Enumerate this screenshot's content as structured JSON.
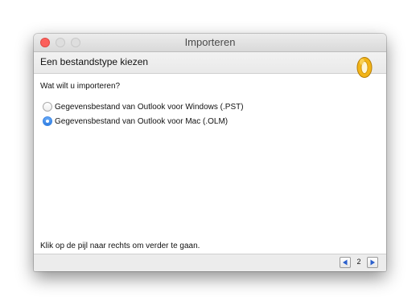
{
  "window": {
    "title": "Importeren"
  },
  "header": {
    "title": "Een bestandstype kiezen",
    "logo_icon": "outlook-logo-icon"
  },
  "content": {
    "question": "Wat wilt u importeren?",
    "options": [
      {
        "label": "Gegevensbestand van Outlook voor Windows (.PST)",
        "selected": false
      },
      {
        "label": "Gegevensbestand van Outlook voor Mac (.OLM)",
        "selected": true
      }
    ],
    "instruction": "Klik op de pijl naar rechts om verder te gaan."
  },
  "footer": {
    "page_number": "2",
    "prev_icon": "arrow-left-icon",
    "next_icon": "arrow-right-icon"
  },
  "colors": {
    "accent": "#2f7de1",
    "close_light": "#fc605c",
    "nav_arrow": "#2a5fcc",
    "logo": "#f2b417"
  }
}
